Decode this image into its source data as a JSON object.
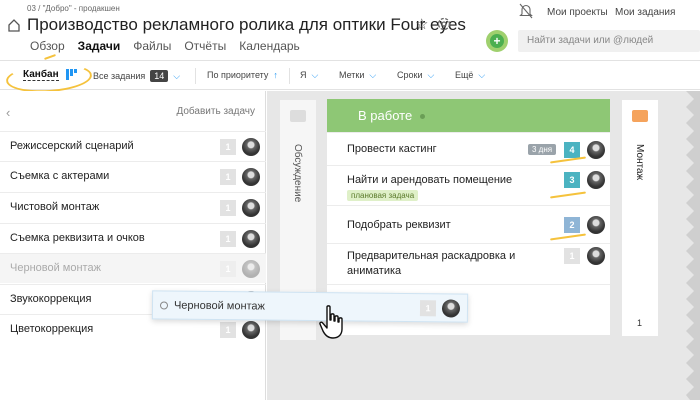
{
  "header": {
    "breadcrumb": "03 / \"Добро\" - продакшен",
    "title": "Производство рекламного ролика для оптики Four eyes",
    "tabs": [
      "Обзор",
      "Задачи",
      "Файлы",
      "Отчёты",
      "Календарь"
    ],
    "active_tab": "Задачи",
    "my_projects": "Мои проекты",
    "my_tasks": "Мои задания",
    "search_placeholder": "Найти задачи или @людей"
  },
  "toolbar": {
    "view_label": "Канбан",
    "all_tasks": "Все задания",
    "all_tasks_count": "14",
    "sort": "По приоритету",
    "me": "Я",
    "tags": "Метки",
    "deadlines": "Сроки",
    "more": "Ещё"
  },
  "left_panel": {
    "add_task": "Добавить задачу",
    "tasks": [
      {
        "label": "Режиссерский сценарий",
        "count": "1"
      },
      {
        "label": "Съемка с актерами",
        "count": "1"
      },
      {
        "label": "Чистовой монтаж",
        "count": "1"
      },
      {
        "label": "Съемка реквизита и очков",
        "count": "1"
      },
      {
        "label": "Черновой монтаж",
        "count": "1"
      },
      {
        "label": "Звукокоррекция",
        "count": "1"
      },
      {
        "label": "Цветокоррекция",
        "count": "1"
      }
    ]
  },
  "drag_card": {
    "label": "Черновой монтаж",
    "count": "1"
  },
  "board": {
    "discussion_column": "Обсуждение",
    "in_progress_column": "В работе",
    "cards": [
      {
        "label": "Провести кастинг",
        "count": "4",
        "badge": "3 дня"
      },
      {
        "label": "Найти и арендовать помещение",
        "count": "3",
        "badge": "плановая задача"
      },
      {
        "label": "Подобрать реквизит",
        "count": "2"
      },
      {
        "label": "Предварительная раскадровка и аниматика",
        "count": "1"
      }
    ],
    "montage_column": "Монтаж",
    "montage_count": "1"
  },
  "colors": {
    "accent_green": "#8ec775",
    "highlight_yellow": "#f5c23c",
    "link_blue": "#2196f3"
  }
}
